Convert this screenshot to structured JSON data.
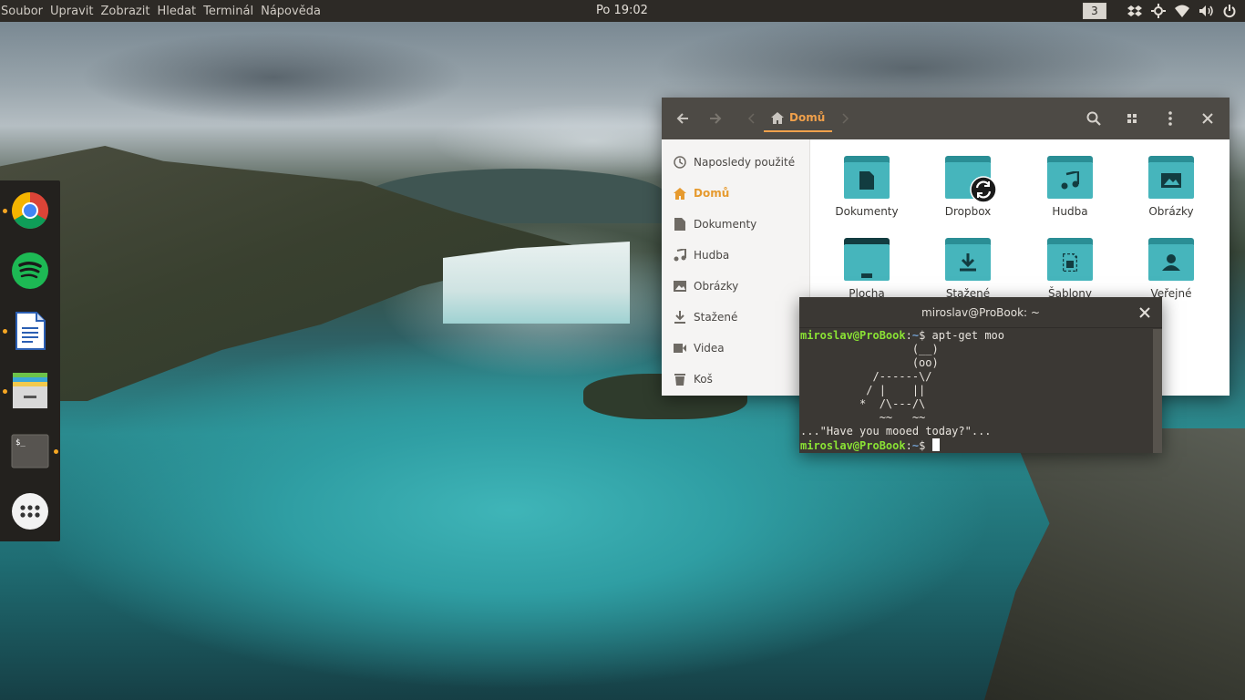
{
  "top_panel": {
    "menus": [
      "Soubor",
      "Upravit",
      "Zobrazit",
      "Hledat",
      "Terminál",
      "Nápověda"
    ],
    "clock": "Po 19:02",
    "workspace": "3",
    "tray_icons": [
      "dropbox-icon",
      "settings-icon",
      "wifi-icon",
      "volume-icon",
      "power-icon"
    ]
  },
  "dock": {
    "items": [
      {
        "name": "chrome",
        "icon": "chrome-icon",
        "running": true
      },
      {
        "name": "spotify",
        "icon": "spotify-icon",
        "running": false
      },
      {
        "name": "writer",
        "icon": "document-icon",
        "running": true
      },
      {
        "name": "files",
        "icon": "files-icon",
        "running": true
      },
      {
        "name": "terminal",
        "icon": "terminal-icon",
        "running": true
      },
      {
        "name": "apps",
        "icon": "apps-grid-icon",
        "running": false
      }
    ]
  },
  "file_manager": {
    "location": "Domů",
    "sidebar": [
      {
        "label": "Naposledy použité",
        "icon": "clock-icon",
        "active": false
      },
      {
        "label": "Domů",
        "icon": "home-icon",
        "active": true
      },
      {
        "label": "Dokumenty",
        "icon": "document-icon",
        "active": false
      },
      {
        "label": "Hudba",
        "icon": "music-icon",
        "active": false
      },
      {
        "label": "Obrázky",
        "icon": "image-icon",
        "active": false
      },
      {
        "label": "Stažené",
        "icon": "download-icon",
        "active": false
      },
      {
        "label": "Videa",
        "icon": "video-icon",
        "active": false
      },
      {
        "label": "Koš",
        "icon": "trash-icon",
        "active": false
      }
    ],
    "folders": [
      {
        "label": "Dokumenty",
        "icon": "document-icon"
      },
      {
        "label": "Dropbox",
        "icon": "sync-icon"
      },
      {
        "label": "Hudba",
        "icon": "music-icon"
      },
      {
        "label": "Obrázky",
        "icon": "image-icon"
      },
      {
        "label": "Plocha",
        "icon": "desktop-icon"
      },
      {
        "label": "Stažené",
        "icon": "download-icon"
      },
      {
        "label": "Šablony",
        "icon": "template-icon"
      },
      {
        "label": "Veřejné",
        "icon": "user-icon"
      }
    ]
  },
  "terminal": {
    "title": "miroslav@ProBook: ~",
    "prompt_user": "miroslav@ProBook",
    "prompt_path": "~",
    "command": "apt-get moo",
    "cow_lines": [
      "                 (__)",
      "                 (oo)",
      "           /------\\/",
      "          / |    ||",
      "         *  /\\---/\\",
      "            ~~   ~~",
      "...\"Have you mooed today?\"..."
    ]
  }
}
